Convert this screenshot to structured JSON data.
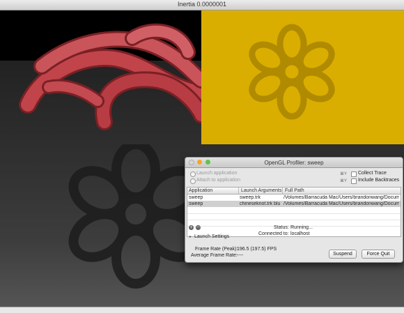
{
  "window": {
    "title": "Inertia 0.0000001"
  },
  "profiler": {
    "title": "OpenGL Profiler: sweep",
    "launch_option": "Launch application",
    "attach_option": "Attach to application",
    "shortcut_1": "⌘Y",
    "shortcut_2": "⌘Y",
    "collect_trace": "Collect Trace",
    "include_backtraces": "Include Backtraces",
    "table": {
      "headers": [
        "Application",
        "Launch Arguments",
        "Full Path"
      ],
      "rows": [
        [
          "sweep",
          "sweep.trk",
          "/Volumes/Barracuda Mac/Users/brandonwang/Docum"
        ],
        [
          "sweep",
          "chineseknot.trk blu",
          "/Volumes/Barracuda Mac/Users/brandonwang/Docum"
        ]
      ]
    },
    "add_label": "+",
    "remove_label": "−",
    "status_label": "Status:",
    "status_value": "Running...",
    "connected_label": "Connected to:",
    "connected_value": "localhost",
    "launch_settings": "Launch Settings",
    "frame_rate_label": "Frame Rate (Peak):",
    "frame_rate_value": "196.5 (197.5) FPS",
    "avg_frame_rate_label": "Average Frame Rate:",
    "avg_frame_rate_value": "----",
    "suspend_button": "Suspend",
    "force_quit_button": "Force Quit"
  },
  "colors": {
    "knot_red": "#c0444a",
    "yellow_bg": "#d9ae00",
    "flower_shadow": "#b08a00"
  }
}
